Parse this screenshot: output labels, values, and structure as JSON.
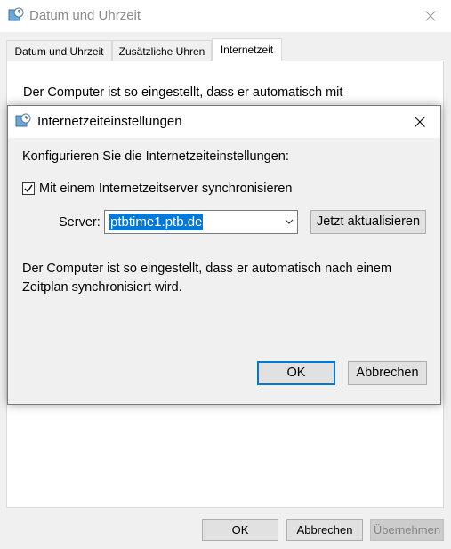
{
  "parent": {
    "title": "Datum und Uhrzeit",
    "tabs": [
      {
        "label": "Datum und Uhrzeit"
      },
      {
        "label": "Zusätzliche Uhren"
      },
      {
        "label": "Internetzeit"
      }
    ],
    "panel_text": "Der Computer ist so eingestellt, dass er automatisch mit",
    "buttons": {
      "ok": "OK",
      "cancel": "Abbrechen",
      "apply": "Übernehmen"
    }
  },
  "dialog": {
    "title": "Internetzeiteinstellungen",
    "heading": "Konfigurieren Sie die Internetzeiteinstellungen:",
    "sync_checkbox_label": "Mit einem Internetzeitserver synchronisieren",
    "sync_checked": true,
    "server_label": "Server:",
    "server_value": "ptbtime1.ptb.de",
    "update_button": "Jetzt aktualisieren",
    "info_line1": "Der Computer ist so eingestellt, dass er automatisch nach einem",
    "info_line2": "Zeitplan synchronisiert wird.",
    "ok_button": "OK",
    "cancel_button": "Abbrechen"
  },
  "colors": {
    "accent": "#0078d7",
    "window_bg": "#f0f0f0",
    "titlebar_bg": "#ffffff"
  },
  "icons": [
    "clock-globe-icon",
    "close-icon",
    "checkmark-icon",
    "chevron-down-icon"
  ]
}
